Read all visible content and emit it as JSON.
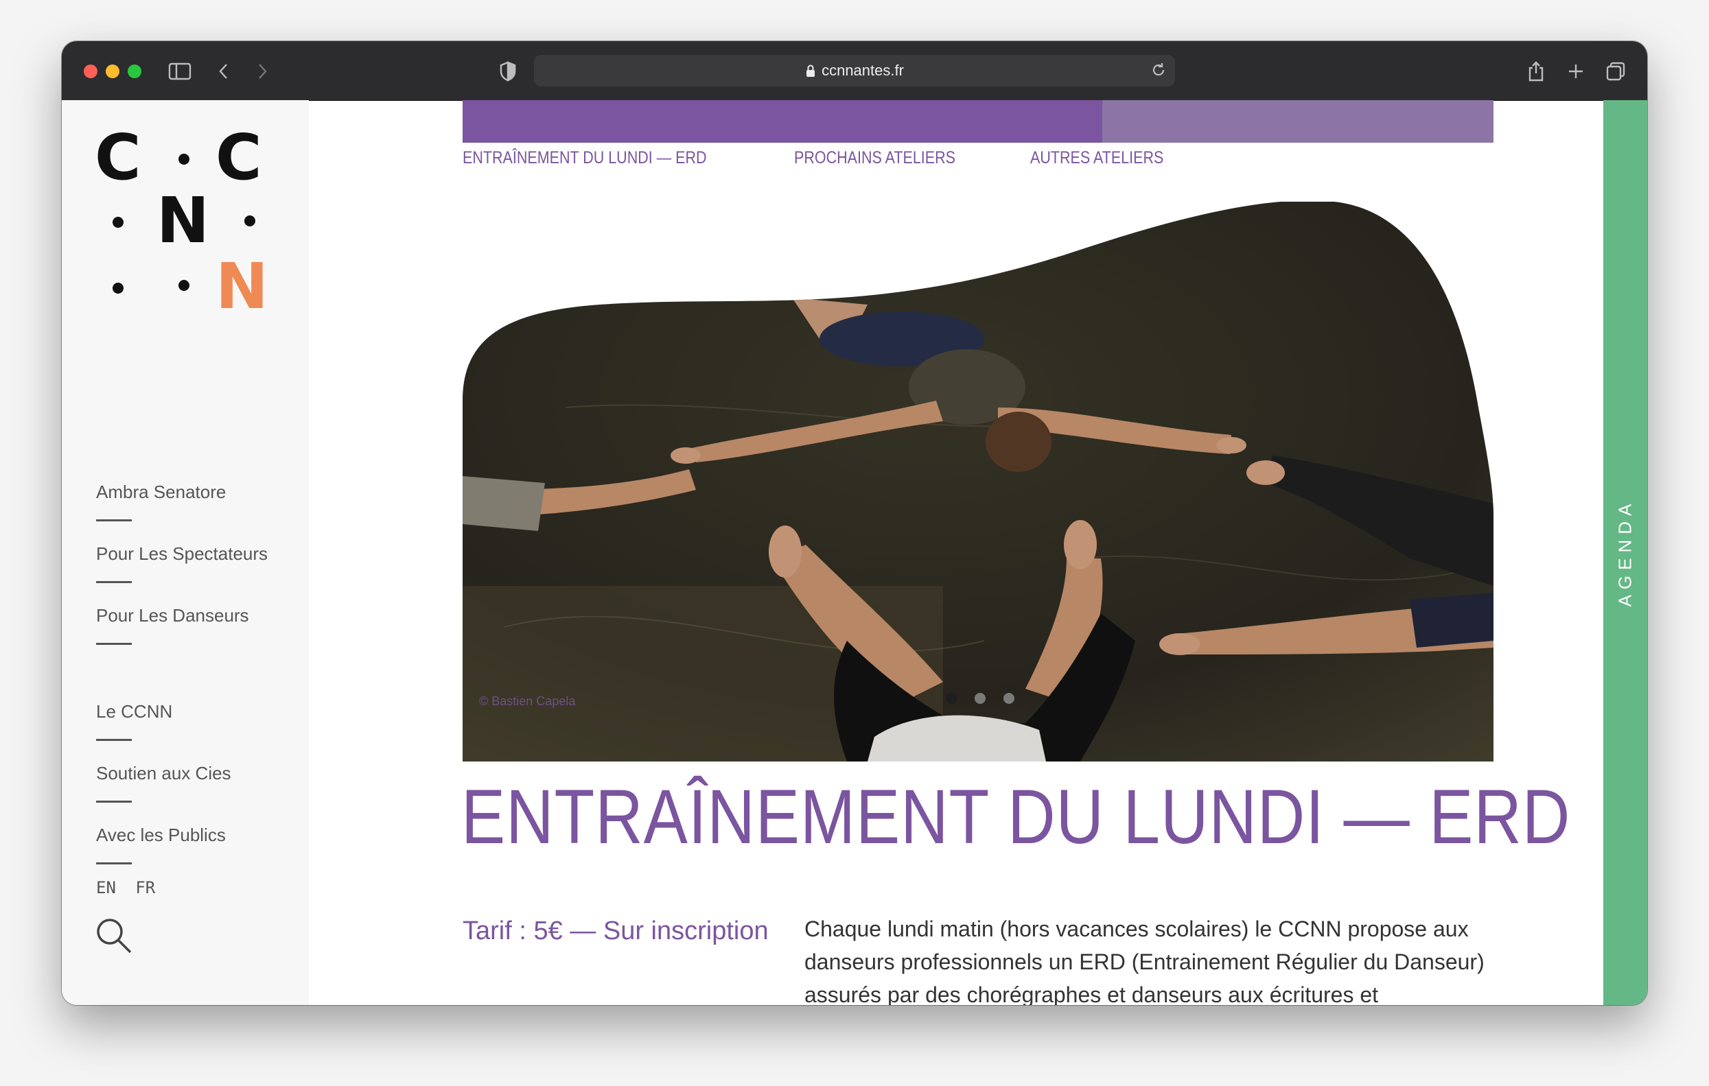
{
  "browser": {
    "url": "ccnnantes.fr"
  },
  "logo": {
    "letters": [
      "C",
      "C",
      "N",
      "N"
    ],
    "accent_color": "#ef8a55"
  },
  "sidebar": {
    "items": [
      {
        "label": "Ambra Senatore"
      },
      {
        "label": "Pour Les Spectateurs"
      },
      {
        "label": "Pour Les Danseurs"
      },
      {
        "label": "Le CCNN"
      },
      {
        "label": "Soutien aux Cies"
      },
      {
        "label": "Avec les Publics"
      }
    ],
    "languages": [
      "EN",
      "FR"
    ]
  },
  "subnav": {
    "tabs": [
      {
        "label": "ENTRAÎNEMENT DU LUNDI — ERD"
      },
      {
        "label": "PROCHAINS ATELIERS"
      },
      {
        "label": "AUTRES ATELIERS"
      }
    ]
  },
  "hero": {
    "credit": "© Bastien Capela",
    "slide_count": 3,
    "active_slide": 1
  },
  "page": {
    "title": "ENTRAÎNEMENT DU LUNDI — ERD",
    "tarif": "Tarif : 5€ — Sur inscription",
    "description": "Chaque lundi matin (hors vacances scolaires) le CCNN propose aux danseurs professionnels un ERD (Entrainement Régulier du Danseur) assurés par des chorégraphes et danseurs aux écritures et"
  },
  "agenda": {
    "label": "AGENDA"
  },
  "colors": {
    "purple": "#7b559f",
    "purple_light": "#8c74a6",
    "green": "#64b886"
  }
}
